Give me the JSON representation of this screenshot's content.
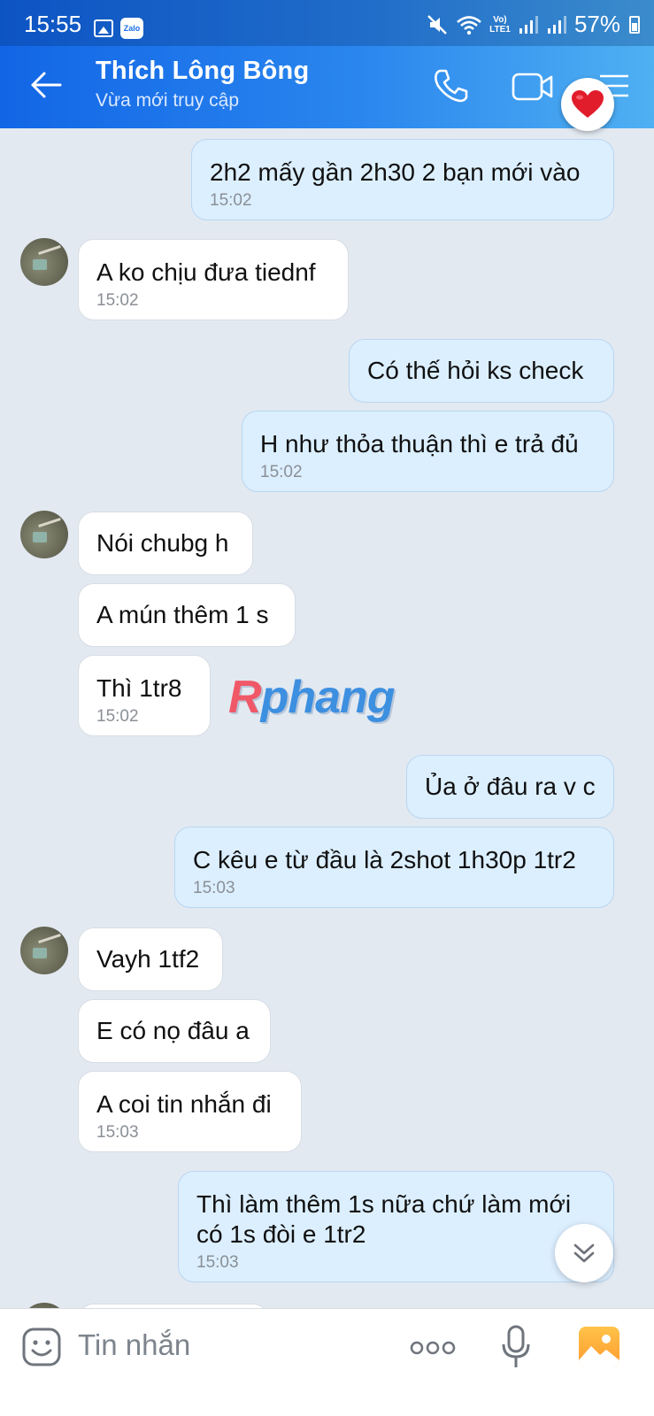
{
  "status_bar": {
    "time": "15:55",
    "zalo_label": "Zalo",
    "network_label": "Vo) LTE1",
    "battery": "57%"
  },
  "header": {
    "title": "Thích Lông Bông",
    "subtitle": "Vừa mới truy cập"
  },
  "messages": [
    {
      "side": "out",
      "text": "2h2 mấy gần 2h30 2 bạn mới vào",
      "time": "15:02"
    },
    {
      "side": "in",
      "text": "A ko chịu đưa tiednf",
      "time": "15:02"
    },
    {
      "side": "out",
      "text": "Có thế hỏi ks check",
      "time": ""
    },
    {
      "side": "out",
      "text": "H như thỏa thuận thì e trả đủ",
      "time": "15:02"
    },
    {
      "side": "in",
      "text": "Nói chubg h",
      "time": ""
    },
    {
      "side": "in",
      "text": "A mún thêm 1 s",
      "time": ""
    },
    {
      "side": "in",
      "text": "Thì 1tr8",
      "time": "15:02"
    },
    {
      "side": "out",
      "text": "Ủa ở đâu ra v c",
      "time": ""
    },
    {
      "side": "out",
      "text": "C kêu e từ đầu là 2shot 1h30p 1tr2",
      "time": "15:03"
    },
    {
      "side": "in",
      "text": "Vayh 1tf2",
      "time": ""
    },
    {
      "side": "in",
      "text": "E có nọ đâu a",
      "time": ""
    },
    {
      "side": "in",
      "text": "A coi tin nhắn đi",
      "time": "15:03"
    },
    {
      "side": "out",
      "text_line1": "Thì làm thêm 1s nữa chứ làm mới",
      "text_line2": "có 1s đòi e 1tr2",
      "time": "15:03"
    }
  ],
  "watermark": {
    "first": "R",
    "rest": "phang"
  },
  "input": {
    "placeholder": "Tin nhắn"
  },
  "colors": {
    "header_gradient_start": "#1266e6",
    "header_gradient_end": "#4fb0f2",
    "background": "#e2e9f1",
    "bubble_out": "#dcefff",
    "bubble_in": "#ffffff"
  }
}
